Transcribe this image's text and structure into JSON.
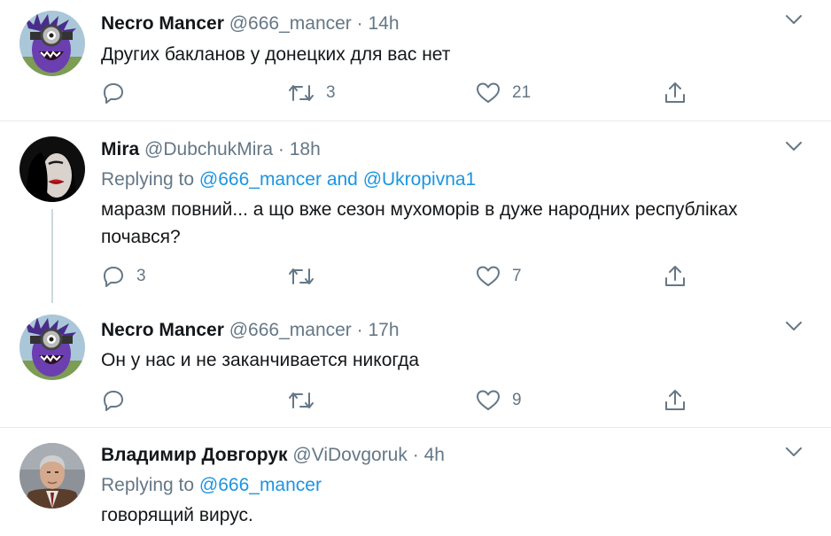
{
  "tweets": [
    {
      "name": "Necro Mancer",
      "handle": "@666_mancer",
      "time": "14h",
      "text": "Других бакланов у донецких для вас нет",
      "replies": "",
      "retweets": "3",
      "likes": "21",
      "avatar": "purple-minion"
    },
    {
      "name": "Mira",
      "handle": "@DubchukMira",
      "time": "18h",
      "replying_prefix": "Replying to",
      "replying_to_1": "@666_mancer",
      "replying_and": "and",
      "replying_to_2": "@Ukropivna1",
      "text": "маразм повний... а що вже сезон  мухоморів в дуже народних республіках почався?",
      "replies": "3",
      "retweets": "",
      "likes": "7",
      "avatar": "red-lips-portrait"
    },
    {
      "name": "Necro Mancer",
      "handle": "@666_mancer",
      "time": "17h",
      "text": "Он у нас и не заканчивается никогда",
      "replies": "",
      "retweets": "",
      "likes": "9",
      "avatar": "purple-minion"
    },
    {
      "name": "Владимир Довгорук",
      "handle": "@ViDovgoruk",
      "time": "4h",
      "replying_prefix": "Replying to",
      "replying_to_1": "@666_mancer",
      "text": "говорящий вирус.",
      "avatar": "man-portrait"
    }
  ],
  "separator": "·",
  "colors": {
    "link": "#1b95e0",
    "muted": "#657786",
    "text": "#14171a",
    "divider": "#e6ecf0",
    "thread_line": "#ccd6dd"
  },
  "icons": [
    "reply-icon",
    "retweet-icon",
    "like-icon",
    "share-icon",
    "chevron-down-icon"
  ]
}
